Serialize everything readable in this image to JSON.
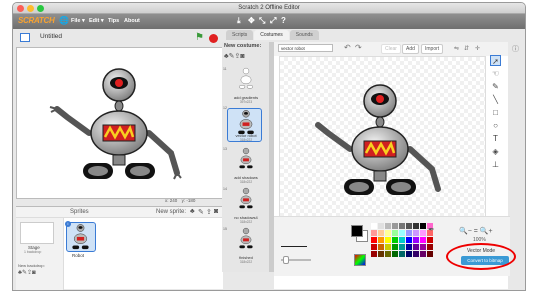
{
  "window": {
    "title": "Scratch 2 Offline Editor"
  },
  "menubar": {
    "logo": "SCRATCH",
    "globe": "🌐",
    "file": "File ▾",
    "edit": "Edit ▾",
    "tips": "Tips",
    "about": "About",
    "tools": [
      "⤓",
      "✥",
      "⤡",
      "⤢",
      "?"
    ]
  },
  "stage_header": {
    "project_name": "Untitled",
    "flag": "⚑"
  },
  "coords": {
    "x_label": "x:",
    "x": "240",
    "y_label": "y:",
    "y": "-180"
  },
  "sprites": {
    "title": "Sprites",
    "new_sprite": "New sprite:",
    "stage_label": "Stage",
    "stage_sub": "1 backdrop",
    "new_backdrop": "New backdrop:",
    "robot_label": "Robot"
  },
  "tabs": [
    "Scripts",
    "Costumes",
    "Sounds"
  ],
  "costumes": {
    "header": "New costume:",
    "items": [
      {
        "num": "11",
        "label": "add gradients",
        "sub": "397x223"
      },
      {
        "num": "12",
        "label": "vector robot",
        "sub": "318x222"
      },
      {
        "num": "13",
        "label": "add shadows",
        "sub": "318x222"
      },
      {
        "num": "14",
        "label": "no shadows4",
        "sub": "318x222"
      },
      {
        "num": "15",
        "label": "finished",
        "sub": "318x222"
      }
    ]
  },
  "editor": {
    "name_value": "vector robot",
    "clear": "Clear",
    "add": "Add",
    "import": "Import",
    "zoom": "100%",
    "mode": "Vector Mode",
    "convert": "Convert to bitmap"
  },
  "colors": {
    "accent": "#3a7bd5",
    "highlight": "#e00000",
    "convert": "#3a9ad5"
  }
}
